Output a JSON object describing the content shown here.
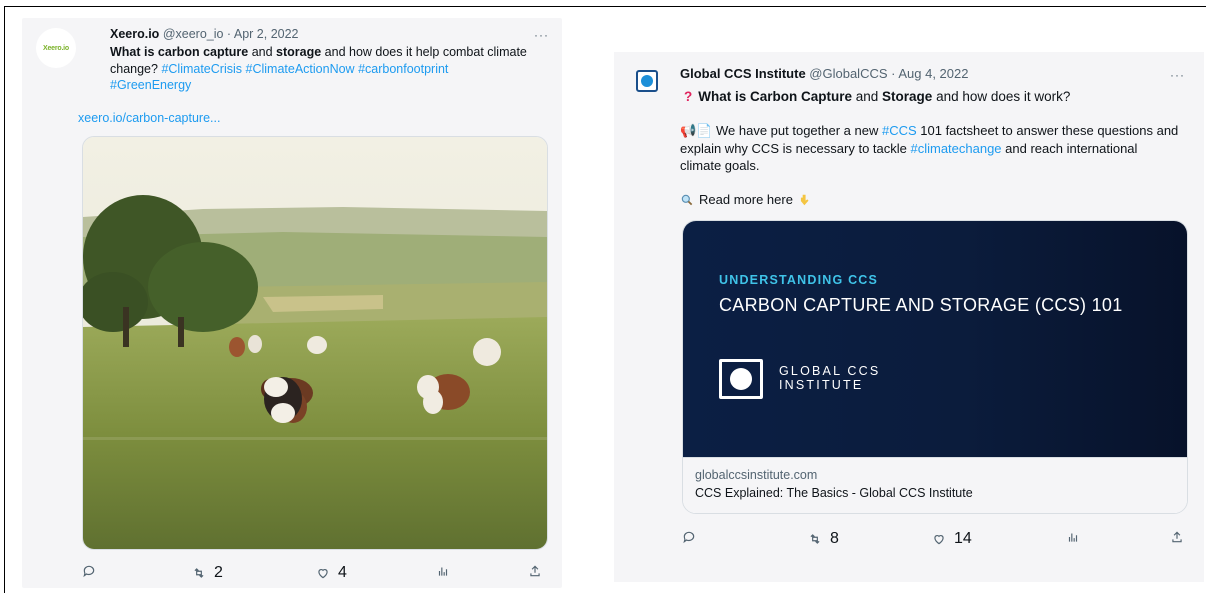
{
  "tweet1": {
    "avatar_text": "Xeero.io",
    "name": "Xeero.io",
    "meta": "@xeero_io · Apr 2, 2022",
    "more": "···",
    "text_parts": {
      "b1": "What is carbon capture",
      "t1": " and ",
      "b2": "storage",
      "t2": " and how does it help combat climate change? "
    },
    "hashtags": [
      "#ClimateCrisis",
      "#ClimateActionNow",
      "#carbonfootprint",
      "#GreenEnergy"
    ],
    "link": "xeero.io/carbon-capture...",
    "image_icon": "cows-grazing-field-photo",
    "actions": {
      "reply": "",
      "retweet": "2",
      "like": "4"
    }
  },
  "tweet2": {
    "name": "Global CCS Institute",
    "meta": "@GlobalCCS · Aug 4, 2022",
    "more": "···",
    "q_mark": "?",
    "question_parts": {
      "b1": "What is Carbon Capture",
      "t1": " and ",
      "b2": "Storage",
      "t2": " and how does it work?"
    },
    "para_parts": {
      "emoji": "📢📄",
      "t1": " We have put together a new ",
      "h1": "#CCS",
      "t2": " 101 factsheet to answer these questions and explain why CCS is necessary to tackle ",
      "h2": "#climatechange",
      "t3": " and reach international climate goals."
    },
    "read_more": "Read more here",
    "read_icon": "magnifier-icon",
    "point_icon": "pointing-down-icon",
    "card": {
      "kicker": "UNDERSTANDING CCS",
      "title": "CARBON CAPTURE AND STORAGE (CCS) 101",
      "logo_line1": "GLOBAL CCS",
      "logo_line2": "INSTITUTE",
      "domain": "globalccsinstitute.com",
      "headline": "CCS Explained: The Basics - Global CCS Institute"
    },
    "actions": {
      "reply": "",
      "retweet": "8",
      "like": "14"
    }
  },
  "colors": {
    "link": "#1d9bf0",
    "card_bg": "#0b1f44",
    "kicker": "#3fc3e8",
    "question_mark": "#e0245e"
  }
}
